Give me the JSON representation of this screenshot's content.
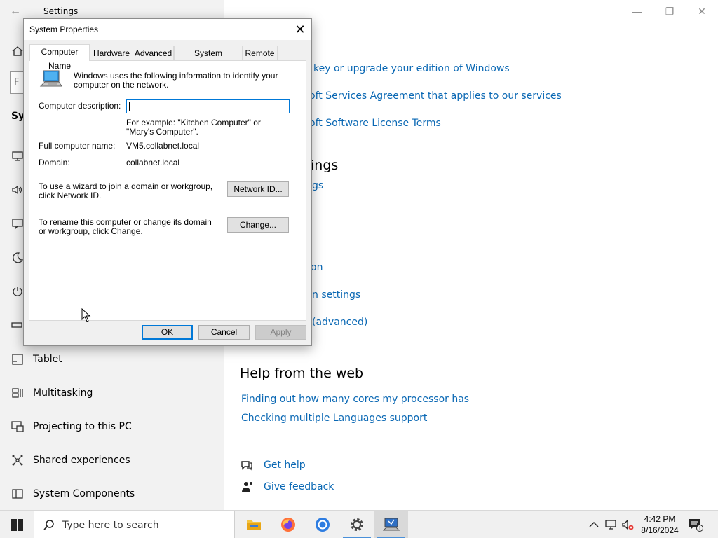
{
  "settings": {
    "title": "Settings",
    "nav": [
      {
        "label": "Tablet",
        "icon": "tablet-icon"
      },
      {
        "label": "Multitasking",
        "icon": "multitasking-icon"
      },
      {
        "label": "Projecting to this PC",
        "icon": "projecting-icon"
      },
      {
        "label": "Shared experiences",
        "icon": "shared-experiences-icon"
      },
      {
        "label": "System Components",
        "icon": "system-components-icon"
      }
    ],
    "partial_heading": "Sys",
    "search_partial": "F",
    "right": {
      "link1": "key or upgrade your edition of Windows",
      "link2": "oft Services Agreement that applies to our services",
      "link3": "oft Software License Terms",
      "heading_settings": "ings",
      "link4": "gs",
      "link5": "on",
      "link6": "n settings",
      "link7": "(advanced)",
      "help_heading": "Help from the web",
      "help_link1": "Finding out how many cores my processor has",
      "help_link2": "Checking multiple Languages support",
      "get_help": "Get help",
      "give_feedback": "Give feedback"
    }
  },
  "dialog": {
    "title": "System Properties",
    "tabs": [
      "Computer Name",
      "Hardware",
      "Advanced",
      "System Protection",
      "Remote"
    ],
    "intro": "Windows uses the following information to identify your computer on the network.",
    "desc_label": "Computer description:",
    "desc_value": "",
    "example": "For example: \"Kitchen Computer\" or \"Mary's Computer\".",
    "fullname_label": "Full computer name:",
    "fullname_value": "VM5.collabnet.local",
    "domain_label": "Domain:",
    "domain_value": "collabnet.local",
    "wizard_text": "To use a wizard to join a domain or workgroup, click Network ID.",
    "network_id_button": "Network ID...",
    "rename_text": "To rename this computer or change its domain or workgroup, click Change.",
    "change_button": "Change...",
    "ok": "OK",
    "cancel": "Cancel",
    "apply": "Apply"
  },
  "taskbar": {
    "search_placeholder": "Type here to search",
    "time": "4:42 PM",
    "date": "8/16/2024",
    "apps": [
      "file-explorer-icon",
      "firefox-icon",
      "chrome-icon",
      "settings-gear-icon",
      "system-properties-icon"
    ]
  },
  "colors": {
    "link": "#0a68b4",
    "accent": "#0078d7",
    "left_pane": "#f2f2f2",
    "dialog_bg": "#f0f0f0"
  }
}
